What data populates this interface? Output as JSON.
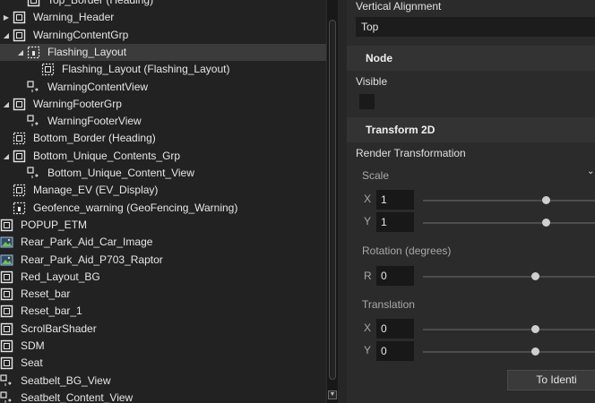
{
  "tree": {
    "items": [
      {
        "label": "Top_Border (Heading)",
        "icon": "visual-icon",
        "expander": "",
        "selected": false
      },
      {
        "label": "Warning_Header",
        "icon": "visual-icon",
        "expander": "▶",
        "selected": false
      },
      {
        "label": "WarningContentGrp",
        "icon": "visual-icon",
        "expander": "◢",
        "selected": false
      },
      {
        "label": "Flashing_Layout",
        "icon": "layout-icon",
        "expander": "◢",
        "selected": true
      },
      {
        "label": "Flashing_Layout (Flashing_Layout)",
        "icon": "layout-instance-icon",
        "expander": "",
        "selected": false
      },
      {
        "label": "WarningContentView",
        "icon": "view-icon",
        "expander": "",
        "selected": false
      },
      {
        "label": "WarningFooterGrp",
        "icon": "visual-icon",
        "expander": "◢",
        "selected": false
      },
      {
        "label": "WarningFooterView",
        "icon": "view-icon",
        "expander": "",
        "selected": false
      },
      {
        "label": "Bottom_Border (Heading)",
        "icon": "layout-instance-icon",
        "expander": "",
        "selected": false
      },
      {
        "label": "Bottom_Unique_Contents_Grp",
        "icon": "visual-icon",
        "expander": "◢",
        "selected": false
      },
      {
        "label": "Bottom_Unique_Content_View",
        "icon": "view-icon",
        "expander": "",
        "selected": false
      },
      {
        "label": "Manage_EV (EV_Display)",
        "icon": "layout-instance-icon",
        "expander": "",
        "selected": false
      },
      {
        "label": "Geofence_warning (GeoFencing_Warning)",
        "icon": "layout-icon",
        "expander": "",
        "selected": false
      },
      {
        "label": "POPUP_ETM",
        "icon": "visual-icon",
        "expander": "",
        "selected": false
      },
      {
        "label": "Rear_Park_Aid_Car_Image",
        "icon": "image-icon",
        "expander": "",
        "selected": false
      },
      {
        "label": "Rear_Park_Aid_P703_Raptor",
        "icon": "image-icon",
        "expander": "",
        "selected": false
      },
      {
        "label": "Red_Layout_BG",
        "icon": "visual-icon",
        "expander": "",
        "selected": false
      },
      {
        "label": "Reset_bar",
        "icon": "visual-icon",
        "expander": "",
        "selected": false
      },
      {
        "label": "Reset_bar_1",
        "icon": "visual-icon",
        "expander": "",
        "selected": false
      },
      {
        "label": "ScrolBarShader",
        "icon": "visual-icon",
        "expander": "",
        "selected": false
      },
      {
        "label": "SDM",
        "icon": "visual-icon",
        "expander": "",
        "selected": false
      },
      {
        "label": "Seat",
        "icon": "visual-icon",
        "expander": "",
        "selected": false
      },
      {
        "label": "Seatbelt_BG_View",
        "icon": "view-icon",
        "expander": "",
        "selected": false
      },
      {
        "label": "Seatbelt_Content_View",
        "icon": "view-icon",
        "expander": "",
        "selected": false
      }
    ]
  },
  "properties": {
    "vertical_alignment_label": "Vertical Alignment",
    "vertical_alignment_value": "Top",
    "node_section": "Node",
    "visible_label": "Visible",
    "visible_checked": false,
    "transform_section": "Transform 2D",
    "render_transformation_label": "Render Transformation",
    "scale_label": "Scale",
    "scale_x_axis": "X",
    "scale_x_value": "1",
    "scale_y_axis": "Y",
    "scale_y_value": "1",
    "rotation_label": "Rotation (degrees)",
    "rotation_axis": "R",
    "rotation_value": "0",
    "translation_label": "Translation",
    "translation_x_axis": "X",
    "translation_x_value": "0",
    "translation_y_axis": "Y",
    "translation_y_value": "0",
    "to_identity_label": "To Identi"
  },
  "colors": {
    "tree_bg": "#222222",
    "selected_row": "#3b3b3b",
    "panel_bg": "#2b2b2b",
    "section_header": "#333333",
    "text": "#e6e6e6"
  }
}
